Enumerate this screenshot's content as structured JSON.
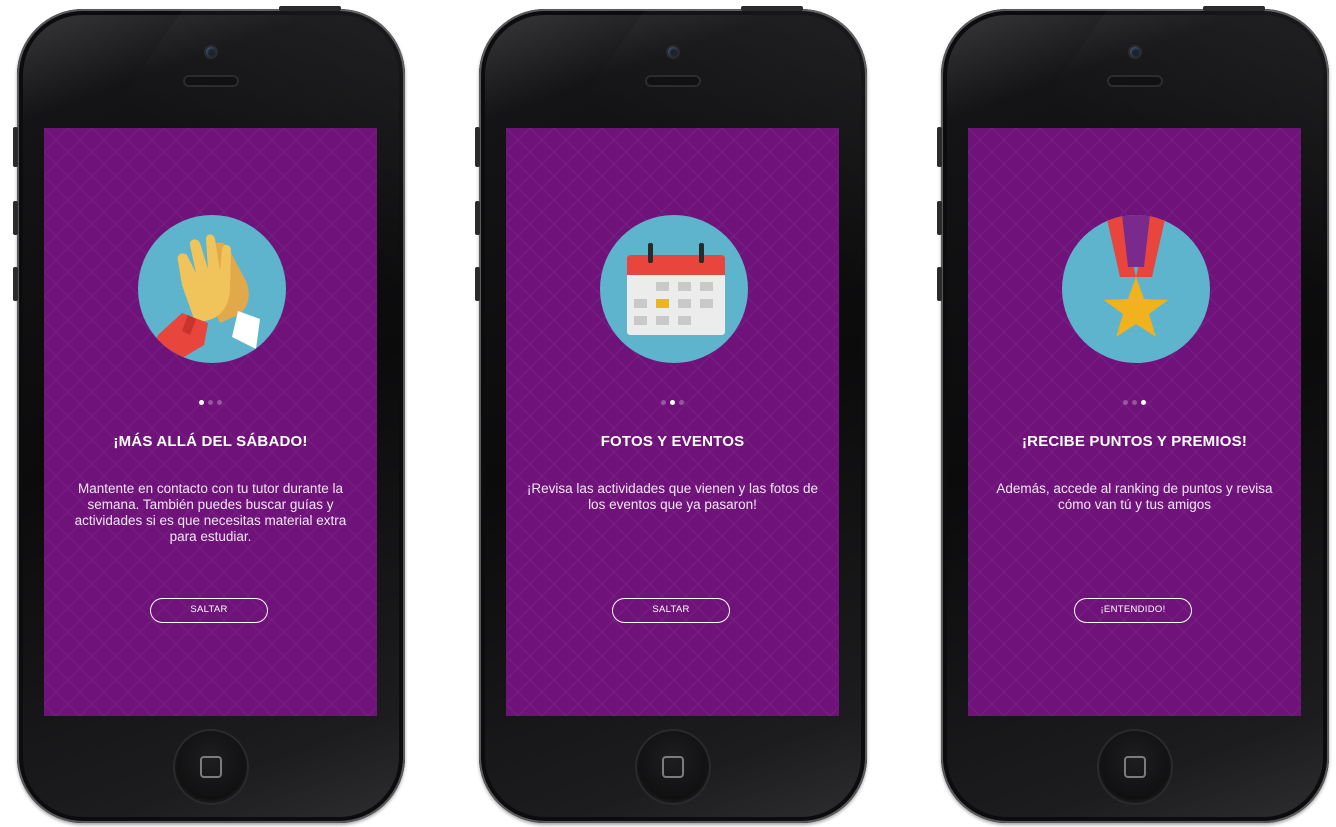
{
  "screens": [
    {
      "illustration": "high-five-icon",
      "active_dot": 0,
      "title": "¡MÁS ALLÁ DEL SÁBADO!",
      "body": "Mantente en contacto con tu tutor durante la semana. También puedes buscar guías y actividades si es que necesitas material extra para estudiar.",
      "button": "SALTAR"
    },
    {
      "illustration": "calendar-icon",
      "active_dot": 1,
      "title": "FOTOS Y EVENTOS",
      "body": "¡Revisa las actividades que vienen y las fotos de los eventos que ya pasaron!",
      "button": "SALTAR"
    },
    {
      "illustration": "medal-star-icon",
      "active_dot": 2,
      "title": "¡RECIBE PUNTOS Y PREMIOS!",
      "body": "Además, accede al ranking de puntos y revisa cómo van tú y tus amigos",
      "button": "¡ENTENDIDO!"
    }
  ],
  "colors": {
    "screen_bg": "#6f137a",
    "illustration_circle": "#5db4cc",
    "calendar_header": "#e8453c",
    "highlight": "#f2b21d"
  }
}
